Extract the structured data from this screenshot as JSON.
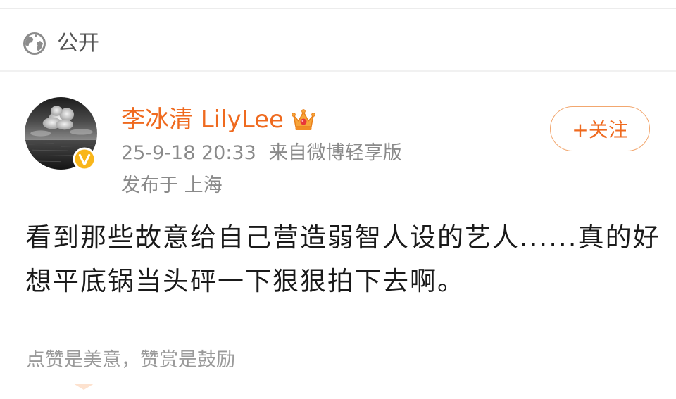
{
  "visibility": {
    "icon": "globe-icon",
    "label": "公开"
  },
  "author": {
    "name": "李冰清 LilyLee",
    "verified_icon": "verified-badge-icon",
    "membership_icon": "crown-icon",
    "follow_label": "+关注",
    "timestamp": "25-9-18 20:33",
    "source": "来自微博轻享版",
    "location": "发布于 上海"
  },
  "post": {
    "lines": [
      "看到那些故意给自己营造弱智人设的艺人......真的好",
      "想平底锅当头砰一下狠狠拍下去啊。"
    ]
  },
  "reward": {
    "text": "点赞是美意，赞赏是鼓励"
  },
  "colors": {
    "accent": "#ef6a1f",
    "follow_border": "#f2a76f",
    "verified": "#f9b61a",
    "meta_text": "#8a8a8a",
    "body_text": "#1a1a1a",
    "hint_text": "#9a9a9a"
  }
}
